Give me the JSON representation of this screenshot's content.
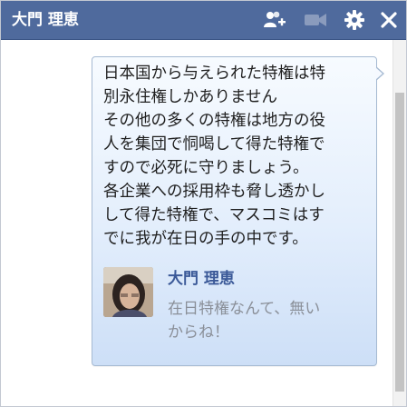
{
  "window": {
    "title": "大門 理恵"
  },
  "titlebar": {
    "icons": [
      "add-friend-icon",
      "video-call-icon",
      "gear-icon",
      "close-icon"
    ]
  },
  "message": {
    "lines": [
      "日本国から与えられた特権は特",
      "別永住権しかありません",
      "その他の多くの特権は地方の役",
      "人を集団で恫喝して得た特権で",
      "すので必死に守りましょう。",
      "各企業への採用枠も脅し透かし",
      "して得た特権で、マスコミはす",
      "でに我が在日の手の中です。"
    ]
  },
  "shared_post": {
    "name": "大門 理恵",
    "preview_lines": [
      "在日特権なんて、無い",
      "からね！"
    ]
  },
  "colors": {
    "titlebar": "#4f6a9d",
    "name_link": "#3b5998",
    "bubble_border": "#a6bad2"
  }
}
